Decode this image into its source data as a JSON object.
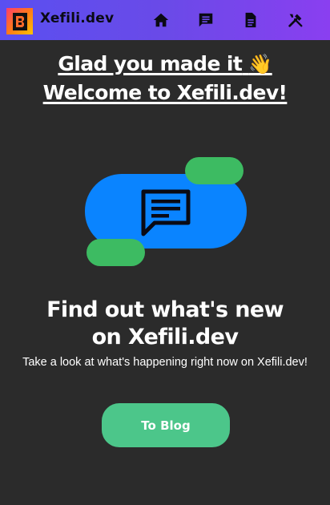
{
  "navbar": {
    "brand": "Xefili.dev",
    "icons": [
      "home-icon",
      "chat-icon",
      "document-icon",
      "tools-icon"
    ],
    "gradient_start": "#5a4ff0",
    "gradient_end": "#8a3ff0"
  },
  "welcome": {
    "line1": "Glad you made it",
    "wave": "👋",
    "line2": "Welcome to Xefili.dev!"
  },
  "hero": {
    "headline_line1": "Find out what's new",
    "headline_line2": "on Xefili.dev",
    "subtitle": "Take a look at what's happening right now on Xefili.dev!",
    "button_label": "To Blog"
  },
  "colors": {
    "background": "#2b2b2b",
    "blue_pill": "#0a84ff",
    "green_pill": "#3dbb62",
    "button": "#4cc68a"
  }
}
